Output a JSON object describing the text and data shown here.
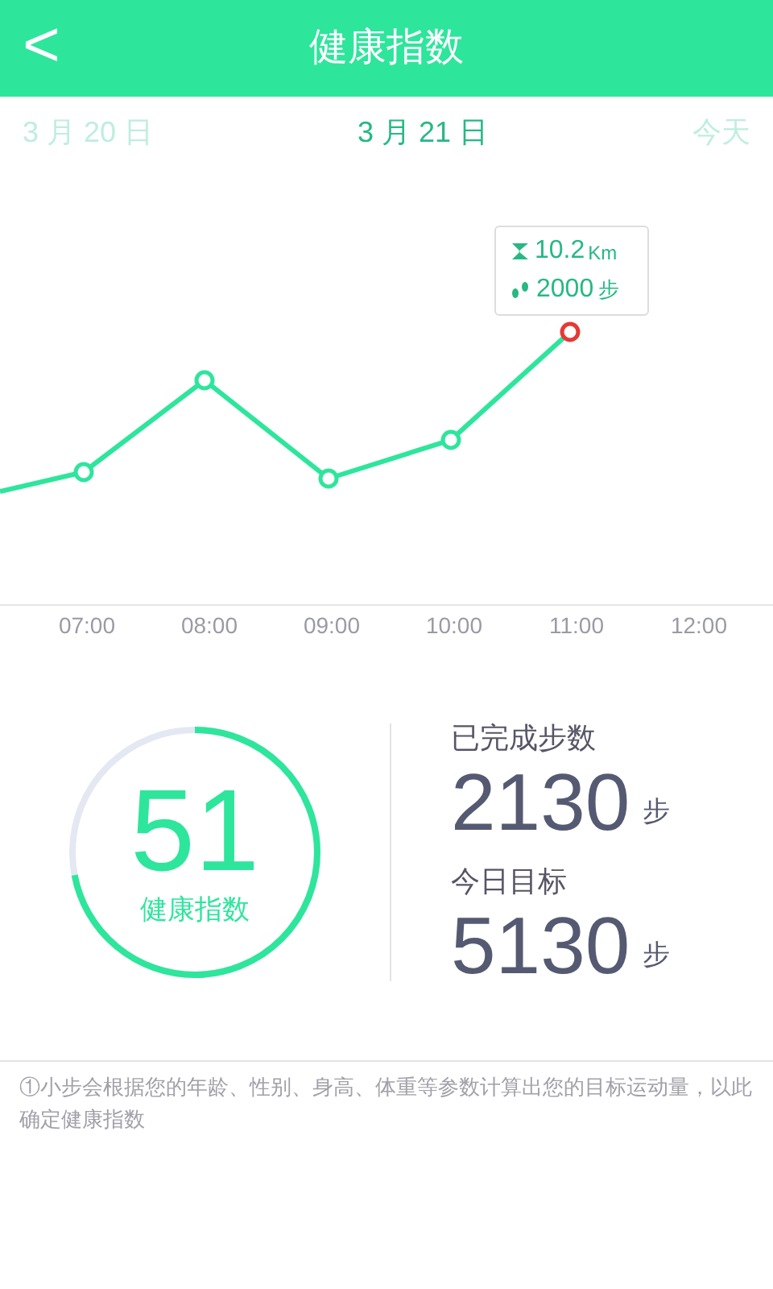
{
  "header": {
    "back": "<",
    "title": "健康指数"
  },
  "dates": [
    {
      "label": "3 月 20 日",
      "selected": false
    },
    {
      "label": "3 月 21 日",
      "selected": true
    },
    {
      "label": "今天",
      "selected": false
    }
  ],
  "tooltip": {
    "distance": "10.2",
    "distance_unit": "Km",
    "steps": "2000",
    "steps_unit": "步"
  },
  "time_labels": [
    "07:00",
    "08:00",
    "09:00",
    "10:00",
    "11:00",
    "12:00"
  ],
  "health": {
    "value": "51",
    "label": "健康指数",
    "level": 0.72
  },
  "stats": [
    {
      "label": "已完成步数",
      "value": "2130",
      "unit": "步"
    },
    {
      "label": "今日目标",
      "value": "5130",
      "unit": "步"
    }
  ],
  "note": "①小步会根据您的年龄、性别、身高、体重等参数计算出您的目标运动量，以此确定健康指数"
}
